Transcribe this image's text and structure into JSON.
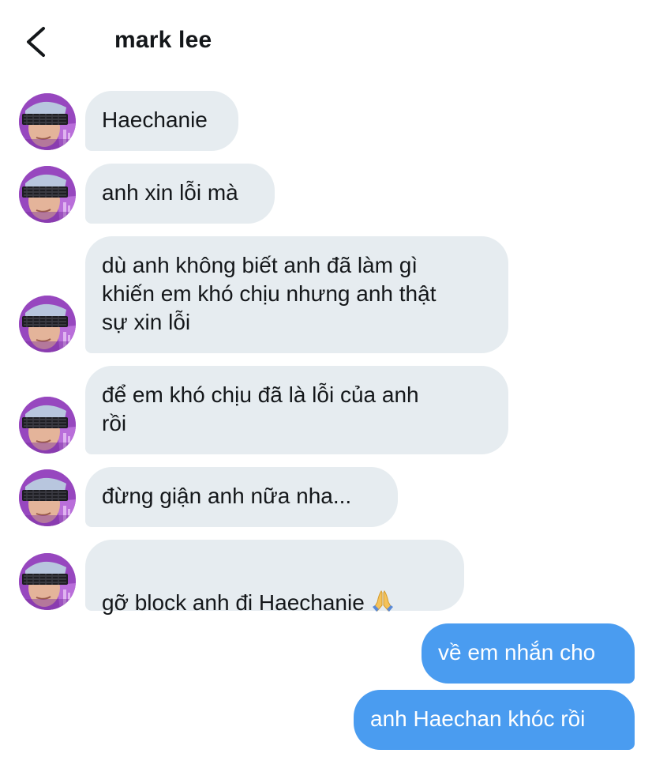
{
  "header": {
    "back_icon": "chevron-left-icon",
    "title": "mark lee"
  },
  "colors": {
    "incoming_bubble": "#e6ecf0",
    "outgoing_bubble": "#4a9cf0",
    "outgoing_text": "#ffffff",
    "text": "#14171a"
  },
  "messages": [
    {
      "sender": "mark lee",
      "direction": "incoming",
      "text": "Haechanie"
    },
    {
      "sender": "mark lee",
      "direction": "incoming",
      "text": "anh xin lỗi mà"
    },
    {
      "sender": "mark lee",
      "direction": "incoming",
      "text": "dù anh không biết anh đã làm gì\nkhiến em khó chịu nhưng anh thật\nsự xin lỗi"
    },
    {
      "sender": "mark lee",
      "direction": "incoming",
      "text": "để em khó chịu đã là lỗi của anh\nrồi"
    },
    {
      "sender": "mark lee",
      "direction": "incoming",
      "text": "đừng giận anh nữa nha..."
    },
    {
      "sender": "mark lee",
      "direction": "incoming",
      "text": "gỡ block anh đi Haechanie",
      "emoji": "folded-hands-icon"
    },
    {
      "sender": "me",
      "direction": "outgoing",
      "text": "về em nhắn cho"
    },
    {
      "sender": "me",
      "direction": "outgoing",
      "text": "anh Haechan khóc rồi"
    }
  ]
}
